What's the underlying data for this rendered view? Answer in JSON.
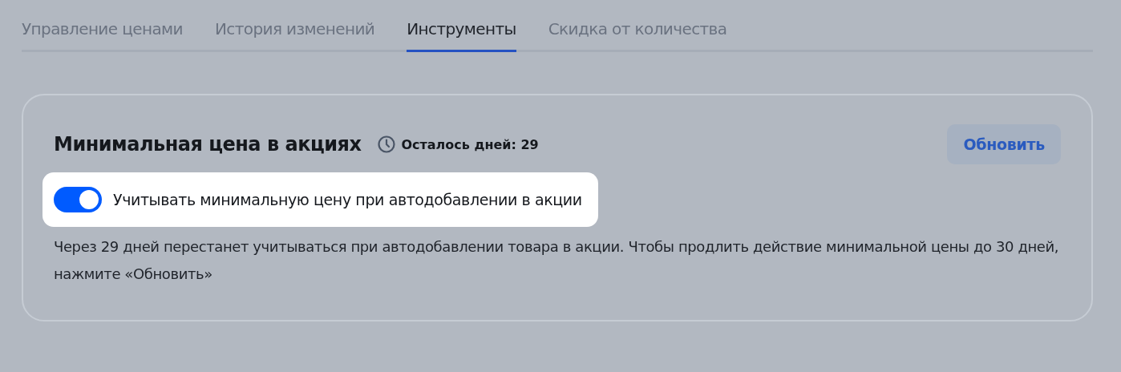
{
  "tabs": [
    {
      "label": "Управление ценами",
      "selected": false
    },
    {
      "label": "История изменений",
      "selected": false
    },
    {
      "label": "Инструменты",
      "selected": true
    },
    {
      "label": "Скидка от количества",
      "selected": false
    }
  ],
  "card": {
    "title": "Минимальная цена в акциях",
    "days_left": "Осталось дней: 29",
    "button": "Обновить",
    "toggle": {
      "label": "Учитывать минимальную цену при автодобавлении в акции",
      "on": true
    },
    "description": "Через 29 дней перестанет учитываться при автодобавлении товара в акции. Чтобы продлить действие минимальной цены до 30 дней, нажмите «Обновить»"
  }
}
